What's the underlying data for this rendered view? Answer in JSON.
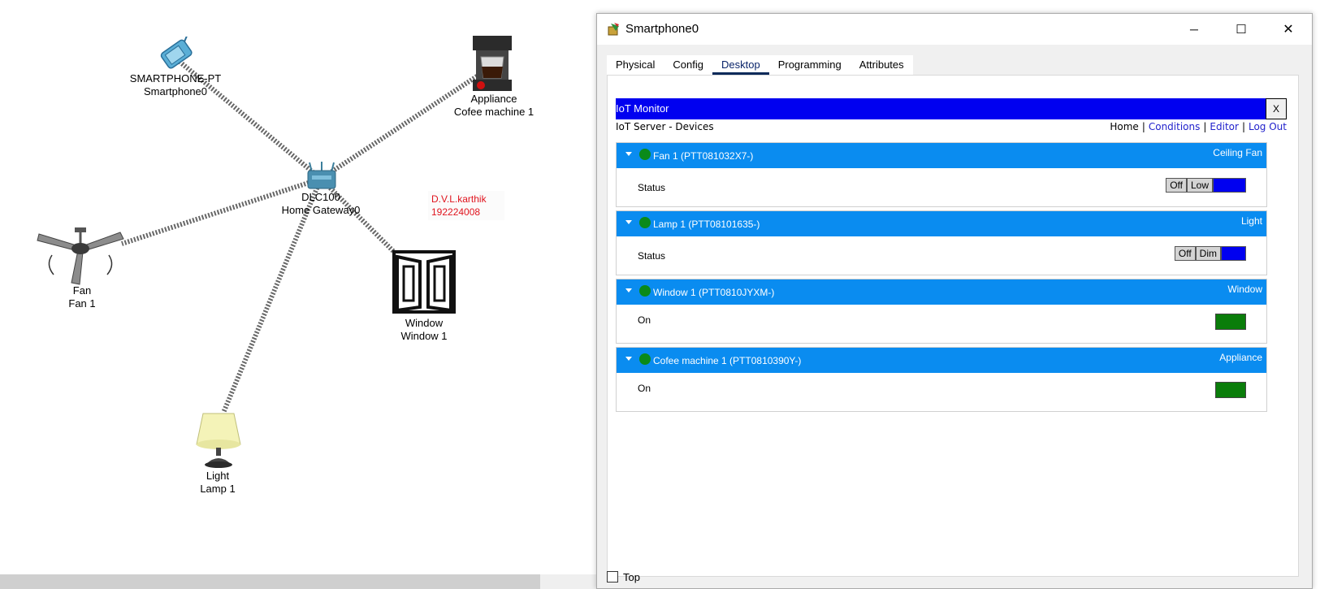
{
  "canvas": {
    "devices": {
      "smartphone": {
        "type": "SMARTPHONE-PT",
        "name": "Smartphone0"
      },
      "coffee": {
        "type": "Appliance",
        "name": "Cofee machine 1"
      },
      "gateway": {
        "type": "DLC100",
        "name": "Home Gateway0"
      },
      "fan": {
        "type": "Fan",
        "name": "Fan 1"
      },
      "window": {
        "type": "Window",
        "name": "Window 1"
      },
      "lamp": {
        "type": "Light",
        "name": "Lamp 1"
      }
    },
    "note": {
      "line1": "D.V.L.karthik",
      "line2": "192224008"
    }
  },
  "window": {
    "title": "Smartphone0",
    "controls": {
      "minimize": "─",
      "maximize": "☐",
      "close": "✕"
    },
    "tabs": [
      "Physical",
      "Config",
      "Desktop",
      "Programming",
      "Attributes"
    ],
    "active_tab": "Desktop",
    "top_checkbox_label": "Top"
  },
  "iot": {
    "title": "IoT Monitor",
    "close": "X",
    "subtitle": "IoT Server - Devices",
    "nav": {
      "home": "Home",
      "conditions": "Conditions",
      "editor": "Editor",
      "logout": "Log Out",
      "sep": "|"
    },
    "devices": [
      {
        "name": "Fan 1 (PTT081032X7-)",
        "type": "Ceiling Fan",
        "prop": "Status",
        "buttons": [
          "Off",
          "Low"
        ],
        "status_color": "#0a8a1a"
      },
      {
        "name": "Lamp 1 (PTT08101635-)",
        "type": "Light",
        "prop": "Status",
        "buttons": [
          "Off",
          "Dim"
        ],
        "status_color": "#0a8a1a"
      },
      {
        "name": "Window 1 (PTT0810JYXM-)",
        "type": "Window",
        "prop": "On",
        "status_color": "#0a8a1a"
      },
      {
        "name": "Cofee machine 1 (PTT0810390Y-)",
        "type": "Appliance",
        "prop": "On",
        "status_color": "#0a8a1a"
      }
    ]
  },
  "colors": {
    "accent_blue": "#0000f0",
    "device_header": "#0a8cf0",
    "on_green": "#0a7d0a",
    "note_red": "#e0141e"
  }
}
